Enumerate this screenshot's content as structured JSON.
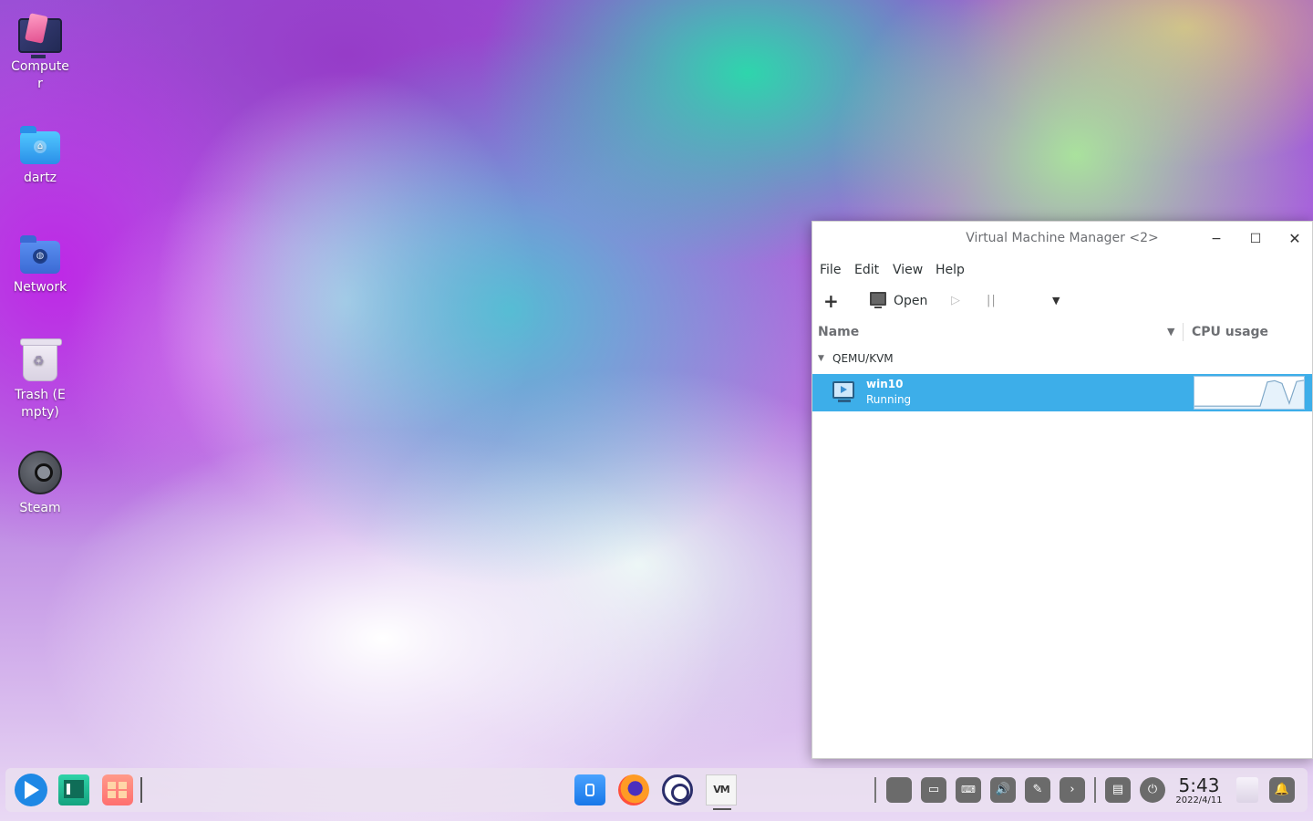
{
  "desktop": {
    "icons": [
      {
        "label": "Computer",
        "icon": "computer-icon"
      },
      {
        "label": "dartz",
        "icon": "home-folder-icon"
      },
      {
        "label": "Network",
        "icon": "network-folder-icon"
      },
      {
        "label": "Trash (Empty)",
        "icon": "trash-icon"
      },
      {
        "label": "Steam",
        "icon": "steam-icon"
      }
    ]
  },
  "window": {
    "title": "Virtual Machine Manager <2>",
    "controls": {
      "minimize": "−",
      "maximize": "☐",
      "close": "✕"
    },
    "menu": [
      "File",
      "Edit",
      "View",
      "Help"
    ],
    "toolbar": {
      "new_icon": "+",
      "open_label": "Open",
      "run_icon": "▷",
      "pause_icon": "||",
      "menu_icon": "▼"
    },
    "columns": {
      "name": "Name",
      "sort_icon": "▼",
      "cpu": "CPU usage"
    },
    "group": {
      "label": "QEMU/KVM",
      "expander_icon": "▼"
    },
    "vms": [
      {
        "name": "win10",
        "state": "Running",
        "cpu_trend": [
          0,
          0,
          0,
          0,
          0,
          0,
          0,
          0,
          0,
          0,
          0.9,
          0.95,
          0.85,
          0.1,
          0.92,
          0.96
        ]
      }
    ]
  },
  "taskbar": {
    "left_apps": [
      "launcher-icon",
      "terminal-icon",
      "app-center-icon"
    ],
    "center_apps": [
      "app-store-icon",
      "firefox-icon",
      "settings-icon",
      "virt-manager-icon"
    ],
    "vmm_text": "VM",
    "tray": {
      "keyboard_glyph": "⌨",
      "volume_glyph": "🔊",
      "arrow_glyph": "›",
      "power_glyph": "⏻",
      "bell_glyph": "🔔"
    },
    "clock": {
      "time": "5:43",
      "date": "2022/4/11"
    }
  },
  "colors": {
    "selection": "#3daee9",
    "taskbar_bg": "#ebe1f0"
  }
}
